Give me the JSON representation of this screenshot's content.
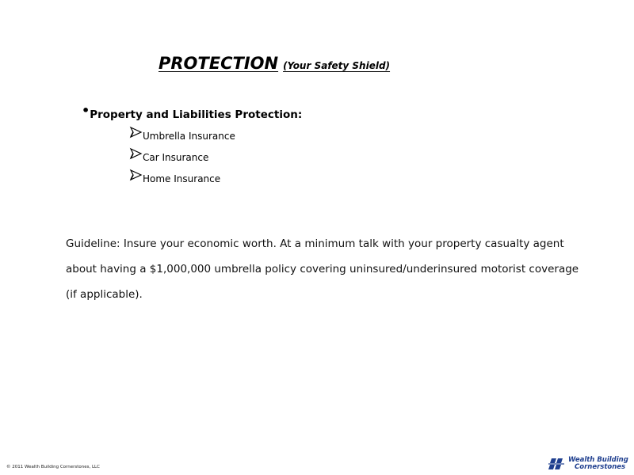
{
  "title": {
    "main": "PROTECTION",
    "sub": "(Your Safety Shield)"
  },
  "bullet": {
    "marker": "•",
    "heading": "Property and Liabilities Protection:",
    "items": [
      {
        "label": "Umbrella Insurance",
        "icon": "arrow-icon"
      },
      {
        "label": "Car Insurance",
        "icon": "arrow-icon"
      },
      {
        "label": "Home Insurance",
        "icon": "arrow-icon"
      }
    ]
  },
  "guideline": {
    "text": "Guideline: Insure your economic worth. At a minimum talk with your property casualty agent about having a $1,000,000 umbrella policy covering uninsured/underinsured motorist coverage (if applicable)."
  },
  "footer": {
    "copyright": "© 2011 Wealth Building Cornerstones, LLC",
    "logo_line_1": "Wealth Building",
    "logo_line_2": "Cornerstones",
    "logo_color": "#1f3f8f"
  }
}
